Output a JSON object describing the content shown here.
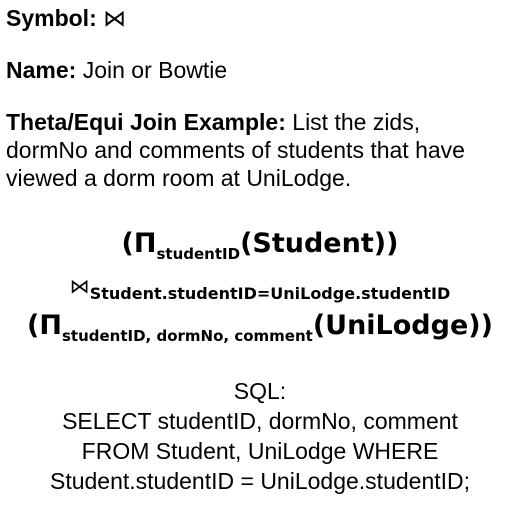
{
  "symbol": {
    "label": "Symbol:",
    "value": "⋈"
  },
  "name": {
    "label": "Name:",
    "value": "Join or Bowtie"
  },
  "example": {
    "label": "Theta/Equi Join Example:",
    "text": "List the zids, dormNo and comments of students that have viewed a dorm room at UniLodge."
  },
  "relational_algebra": {
    "line1": {
      "open": "(Π",
      "sub": "studentID",
      "rest": "(Student))"
    },
    "line2": {
      "symbol": "⋈",
      "condition": "Student.studentID=UniLodge.studentID"
    },
    "line3": {
      "open": "(Π",
      "sub": "studentID, dormNo, comment",
      "rest": "(UniLodge))"
    }
  },
  "sql": {
    "label": "SQL:",
    "line1": "SELECT studentID, dormNo, comment",
    "line2": "FROM Student, UniLodge WHERE",
    "line3": "Student.studentID = UniLodge.studentID;"
  }
}
